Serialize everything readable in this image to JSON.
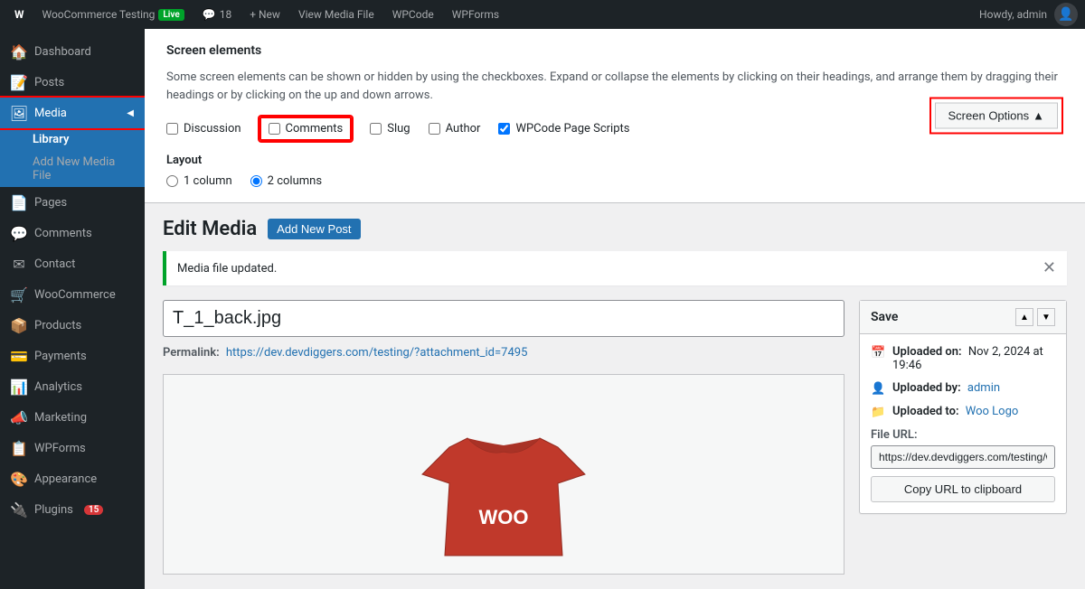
{
  "adminBar": {
    "wpIcon": "W",
    "siteName": "WooCommerce Testing",
    "liveBadge": "Live",
    "commentCount": "18",
    "commentIcon": "💬",
    "newLabel": "+ New",
    "viewMediaFile": "View Media File",
    "wpCode": "WPCode",
    "wpForms": "WPForms",
    "howdy": "Howdy, admin"
  },
  "sidebar": {
    "items": [
      {
        "id": "dashboard",
        "label": "Dashboard",
        "icon": "🏠"
      },
      {
        "id": "posts",
        "label": "Posts",
        "icon": "📝"
      },
      {
        "id": "media",
        "label": "Media",
        "icon": "🖼",
        "active": true
      },
      {
        "id": "pages",
        "label": "Pages",
        "icon": "📄"
      },
      {
        "id": "comments",
        "label": "Comments",
        "icon": "💬"
      },
      {
        "id": "contact",
        "label": "Contact",
        "icon": "✉"
      },
      {
        "id": "woocommerce",
        "label": "WooCommerce",
        "icon": "🛒"
      },
      {
        "id": "products",
        "label": "Products",
        "icon": "📦"
      },
      {
        "id": "payments",
        "label": "Payments",
        "icon": "💳"
      },
      {
        "id": "analytics",
        "label": "Analytics",
        "icon": "📊"
      },
      {
        "id": "marketing",
        "label": "Marketing",
        "icon": "📣"
      },
      {
        "id": "wpforms",
        "label": "WPForms",
        "icon": "📋"
      },
      {
        "id": "appearance",
        "label": "Appearance",
        "icon": "🎨"
      },
      {
        "id": "plugins",
        "label": "Plugins",
        "icon": "🔌",
        "badge": "15"
      }
    ],
    "mediaSubItems": [
      {
        "id": "library",
        "label": "Library",
        "active": true
      },
      {
        "id": "add-new",
        "label": "Add New Media File"
      }
    ]
  },
  "screenOptions": {
    "panelTitle": "Screen elements",
    "description": "Some screen elements can be shown or hidden by using the checkboxes. Expand or collapse the elements by clicking on their headings, and arrange them by dragging their headings or by clicking on the up and down arrows.",
    "checkboxes": [
      {
        "id": "discussion",
        "label": "Discussion",
        "checked": false
      },
      {
        "id": "comments",
        "label": "Comments",
        "checked": false,
        "highlighted": true
      },
      {
        "id": "slug",
        "label": "Slug",
        "checked": false
      },
      {
        "id": "author",
        "label": "Author",
        "checked": false
      },
      {
        "id": "wpcode",
        "label": "WPCode Page Scripts",
        "checked": true
      }
    ],
    "layoutLabel": "Layout",
    "layoutOptions": [
      {
        "id": "1col",
        "label": "1 column",
        "checked": false
      },
      {
        "id": "2col",
        "label": "2 columns",
        "checked": true
      }
    ],
    "buttonLabel": "Screen Options",
    "buttonIcon": "▲"
  },
  "editMedia": {
    "pageTitle": "Edit Media",
    "addNewLabel": "Add New Post",
    "notice": "Media file updated.",
    "titleValue": "T_1_back.jpg",
    "permalinkLabel": "Permalink:",
    "permalinkUrl": "https://dev.devdiggers.com/testing/?attachment_id=7495"
  },
  "saveBox": {
    "title": "Save",
    "upArrow": "▲",
    "downArrow": "▼",
    "uploadedOnLabel": "Uploaded on:",
    "uploadedOnValue": "Nov 2, 2024 at 19:46",
    "uploadedByLabel": "Uploaded by:",
    "uploadedByValue": "admin",
    "uploadedByLink": "admin",
    "uploadedToLabel": "Uploaded to:",
    "uploadedToValue": "Woo Logo",
    "fileUrlLabel": "File URL:",
    "fileUrlValue": "https://dev.devdiggers.com/testing/wp",
    "copyUrlLabel": "Copy URL to clipboard"
  }
}
